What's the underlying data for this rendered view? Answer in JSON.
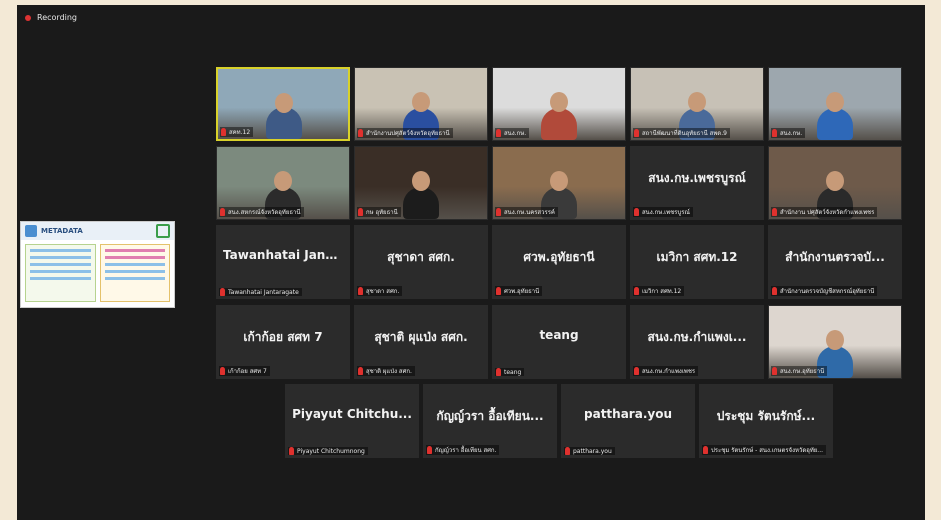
{
  "recording": {
    "label": "Recording"
  },
  "shared": {
    "title": "METADATA"
  },
  "tiles": [
    {
      "name": "สคท.12",
      "big": "",
      "cam": true
    },
    {
      "name": "สำนักงานปศุสัตว์จังหวัดอุทัยธานี",
      "big": "",
      "cam": true
    },
    {
      "name": "สนง.กษ.",
      "big": "",
      "cam": true
    },
    {
      "name": "สถานีพัฒนาที่ดินอุทัยธานี สพด.9",
      "big": "",
      "cam": true
    },
    {
      "name": "สนง.กษ.",
      "big": "",
      "cam": true
    },
    {
      "name": "สนง.สหกรณ์จังหวัดอุทัยธานี",
      "big": "",
      "cam": true
    },
    {
      "name": "กษ อุทัยธานี",
      "big": "",
      "cam": true
    },
    {
      "name": "สนง.กษ.นครสวรรค์",
      "big": "",
      "cam": true
    },
    {
      "name": "สนง.กษ.เพชรบูรณ์",
      "big": "สนง.กษ.เพชรบูรณ์",
      "cam": false
    },
    {
      "name": "สำนักงาน ปศุสัตว์จังหวัดกำแพงเพชร",
      "big": "",
      "cam": true
    },
    {
      "name": "Tawanhatai Jantaragate",
      "big": "Tawanhatai Jant...",
      "cam": false
    },
    {
      "name": "สุชาดา สศก.",
      "big": "สุชาดา สศก.",
      "cam": false
    },
    {
      "name": "ศวพ.อุทัยธานี",
      "big": "ศวพ.อุทัยธานี",
      "cam": false
    },
    {
      "name": "เมวิกา สศท.12",
      "big": "เมวิกา สศท.12",
      "cam": false
    },
    {
      "name": "สำนักงานตรวจบัญชีสหกรณ์อุทัยธานี",
      "big": "สำนักงานตรวจบั...",
      "cam": false
    },
    {
      "name": "เก้าก้อย สศท 7",
      "big": "เก้าก้อย สศท 7",
      "cam": false
    },
    {
      "name": "สุชาติ ผุแป่ง สศก.",
      "big": "สุชาติ ผุแป่ง สศก.",
      "cam": false
    },
    {
      "name": "teang",
      "big": "teang",
      "cam": false
    },
    {
      "name": "สนง.กษ.กำแพงเพชร",
      "big": "สนง.กษ.กำแพงเ...",
      "cam": false
    },
    {
      "name": "สนง.กษ.อุทัยธานี",
      "big": "",
      "cam": true
    },
    {
      "name": "Piyayut Chitchumnong",
      "big": "Piyayut Chitchu...",
      "cam": false
    },
    {
      "name": "กัญญ์วรา อื้อเทียน สศก.",
      "big": "กัญญ์วรา อื้อเทียน...",
      "cam": false
    },
    {
      "name": "patthara.you",
      "big": "patthara.you",
      "cam": false
    },
    {
      "name": "ประชุม รัตนรักษ์ - สนง.เกษตรจังหวัดอุทัย...",
      "big": "ประชุม รัตนรักษ์...",
      "cam": false
    }
  ],
  "colors": {
    "background": "#1a1a1a",
    "tile": "#2b2b2b",
    "active_border": "#d8d12a",
    "mic_muted": "#e0312e"
  }
}
